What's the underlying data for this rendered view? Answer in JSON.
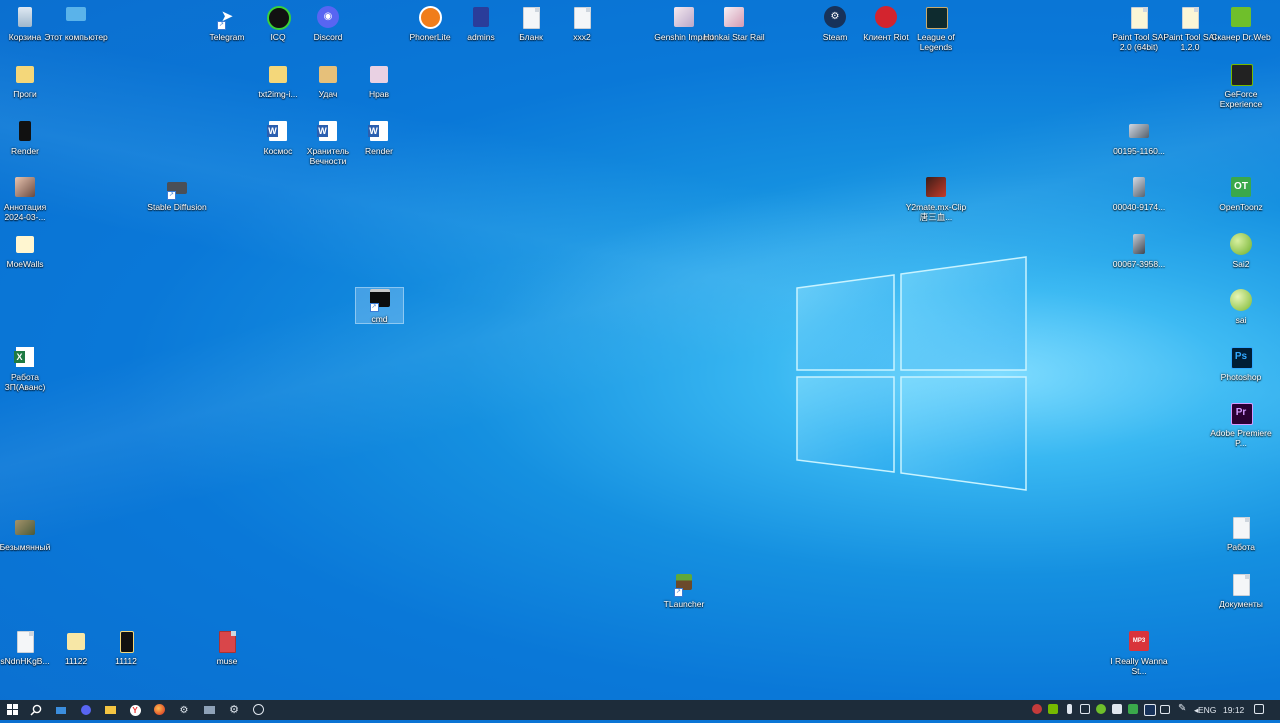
{
  "desktop": {
    "icons": [
      {
        "label": "Корзина",
        "icon": "recycle-bin-icon"
      },
      {
        "label": "Этот компьютер",
        "icon": "computer-icon"
      },
      {
        "label": "Telegram",
        "icon": "telegram-icon"
      },
      {
        "label": "ICQ",
        "icon": "icq-icon"
      },
      {
        "label": "Discord",
        "icon": "discord-icon"
      },
      {
        "label": "PhonerLite",
        "icon": "phonerlite-icon"
      },
      {
        "label": "admins",
        "icon": "admins-icon"
      },
      {
        "label": "Бланк",
        "icon": "file-icon"
      },
      {
        "label": "xxx2",
        "icon": "file-icon"
      },
      {
        "label": "Genshin Impact",
        "icon": "genshin-icon"
      },
      {
        "label": "Honkai Star Rail",
        "icon": "honkai-icon"
      },
      {
        "label": "Steam",
        "icon": "steam-icon"
      },
      {
        "label": "Клиент Riot",
        "icon": "riot-icon"
      },
      {
        "label": "League of Legends",
        "icon": "lol-icon"
      },
      {
        "label": "Paint Tool SAI 2.0 (64bit)",
        "icon": "file-icon"
      },
      {
        "label": "Paint Tool SAI 1.2.0",
        "icon": "file-icon"
      },
      {
        "label": "Сканер Dr.Web",
        "icon": "drweb-icon"
      },
      {
        "label": "Проги",
        "icon": "folder-icon"
      },
      {
        "label": "txt2img-i...",
        "icon": "folder-icon"
      },
      {
        "label": "Удач",
        "icon": "folder-icon"
      },
      {
        "label": "Нрав",
        "icon": "folder-icon"
      },
      {
        "label": "GeForce Experience",
        "icon": "geforce-icon"
      },
      {
        "label": "Render",
        "icon": "render-icon"
      },
      {
        "label": "Космос",
        "icon": "word-doc-icon"
      },
      {
        "label": "Хранитель Вечности",
        "icon": "word-doc-icon"
      },
      {
        "label": "Render",
        "icon": "word-doc-icon"
      },
      {
        "label": "00195-1160...",
        "icon": "image-icon"
      },
      {
        "label": "Аннотация 2024-03-...",
        "icon": "image-icon"
      },
      {
        "label": "Stable Diffusion",
        "icon": "stable-diffusion-icon"
      },
      {
        "label": "Y2mate.mx-Clip 唐三血...",
        "icon": "video-icon"
      },
      {
        "label": "00040-9174...",
        "icon": "image-icon"
      },
      {
        "label": "OpenToonz",
        "icon": "opentoonz-icon"
      },
      {
        "label": "MoeWalls",
        "icon": "folder-icon"
      },
      {
        "label": "00067-3958...",
        "icon": "image-icon"
      },
      {
        "label": "Sai2",
        "icon": "sai-icon"
      },
      {
        "label": "cmd",
        "icon": "cmd-icon"
      },
      {
        "label": "sai",
        "icon": "sai-icon"
      },
      {
        "label": "Работа ЗП(Аванс)",
        "icon": "excel-doc-icon"
      },
      {
        "label": "Photoshop",
        "icon": "photoshop-icon"
      },
      {
        "label": "Adobe Premiere P...",
        "icon": "premiere-icon"
      },
      {
        "label": "Безымянный",
        "icon": "image-icon"
      },
      {
        "label": "Работа",
        "icon": "file-icon"
      },
      {
        "label": "TLauncher",
        "icon": "tlauncher-icon"
      },
      {
        "label": "Документы",
        "icon": "file-icon"
      },
      {
        "label": "sNdnHKgB...",
        "icon": "file-icon"
      },
      {
        "label": "11122",
        "icon": "folder-icon"
      },
      {
        "label": "11112",
        "icon": "render-icon"
      },
      {
        "label": "muse",
        "icon": "file-icon"
      },
      {
        "label": "I Really Wanna St...",
        "icon": "mp3-icon"
      }
    ]
  },
  "taskbar": {
    "start": "windows-start-icon",
    "pinned": [
      "search-icon",
      "task-view-icon",
      "discord-icon",
      "file-explorer-icon",
      "yandex-browser-icon",
      "firefox-icon",
      "steam-icon",
      "app-icon",
      "settings-icon",
      "obs-icon"
    ],
    "tray": {
      "language": "ENG",
      "time": "19:12"
    }
  },
  "colors": {
    "desktop_bg": "#0b6fd0",
    "taskbar_bg": "#1d2c3a",
    "selection": "#c8e6ff"
  }
}
